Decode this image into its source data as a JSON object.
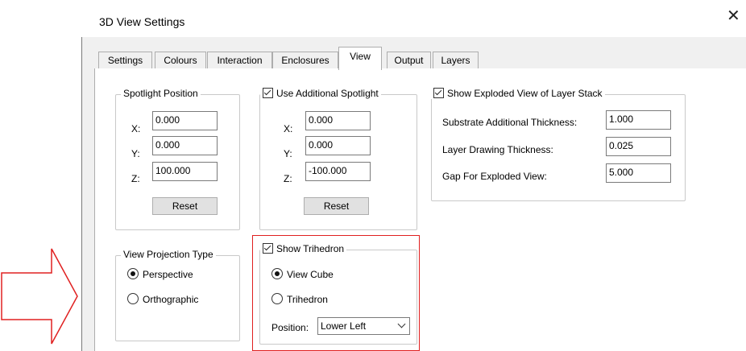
{
  "window": {
    "title": "3D View Settings",
    "close_glyph": "✕"
  },
  "tabs": [
    "Settings",
    "Colours",
    "Interaction",
    "Enclosures",
    "View",
    "Output",
    "Layers"
  ],
  "active_tab": "View",
  "spotlight_position": {
    "legend": "Spotlight Position",
    "x_label": "X:",
    "x": "0.000",
    "y_label": "Y:",
    "y": "0.000",
    "z_label": "Z:",
    "z": "100.000",
    "reset": "Reset"
  },
  "additional_spotlight": {
    "legend": "Use Additional Spotlight",
    "checked": true,
    "x_label": "X:",
    "x": "0.000",
    "y_label": "Y:",
    "y": "0.000",
    "z_label": "Z:",
    "z": "-100.000",
    "reset": "Reset"
  },
  "exploded_view": {
    "legend": "Show Exploded View of Layer Stack",
    "checked": true,
    "substrate_label": "Substrate Additional Thickness:",
    "substrate": "1.000",
    "layer_label": "Layer Drawing Thickness:",
    "layer": "0.025",
    "gap_label": "Gap For Exploded View:",
    "gap": "5.000"
  },
  "projection": {
    "legend": "View Projection Type",
    "perspective": "Perspective",
    "orthographic": "Orthographic",
    "selected": "Perspective"
  },
  "trihedron": {
    "legend": "Show Trihedron",
    "checked": true,
    "view_cube": "View Cube",
    "trihedron": "Trihedron",
    "selected": "View Cube",
    "position_label": "Position:",
    "position_value": "Lower Left"
  },
  "colors": {
    "highlight_box": "#e02020",
    "arrow": "#e02020"
  }
}
